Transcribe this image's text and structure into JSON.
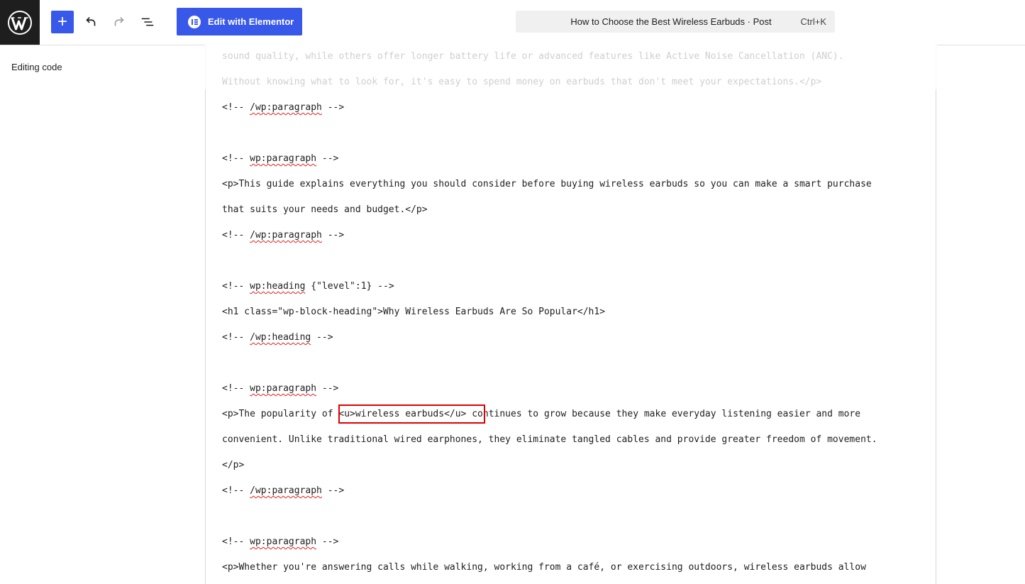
{
  "toolbar": {
    "elementor_label": "Edit with Elementor",
    "add_label": "+",
    "document_title": "How to Choose the Best Wireless Earbuds · Post",
    "shortcut": "Ctrl+K"
  },
  "sidebar": {
    "editing_label": "Editing code"
  },
  "code": {
    "lines": [
      "sound quality, while others offer longer battery life or advanced features like Active Noise Cancellation (ANC).",
      "Without knowing what to look for, it's easy to spend money on earbuds that don't meet your expectations.</p>",
      "/wp:paragraph",
      "wp:paragraph",
      "<p>This guide explains everything you should consider before buying wireless earbuds so you can make a smart purchase",
      "that suits your needs and budget.</p>",
      "/wp:paragraph",
      "wp:heading",
      " {\"level\":1} -->",
      "<h1 class=\"wp-block-heading\">Why Wireless Earbuds Are So Popular</h1>",
      "/wp:heading",
      "wp:paragraph",
      "<p>The popularity of ",
      "<u>wireless earbuds</u>",
      " continues to grow because they make everyday listening easier and more",
      "convenient. Unlike traditional wired earphones, they eliminate tangled cables and provide greater freedom of movement.",
      "</p>",
      "/wp:paragraph",
      "wp:paragraph",
      "<p>Whether you're answering calls while walking, working from a café, or exercising outdoors, wireless earbuds allow"
    ],
    "comment_open": "<!-- ",
    "comment_close": " -->"
  },
  "icons": {
    "logo": "wordpress-logo-icon",
    "undo": "undo-icon",
    "redo": "redo-icon",
    "outline": "document-overview-icon",
    "elementor": "elementor-icon"
  },
  "colors": {
    "accent": "#3858e9",
    "highlight": "#e00000",
    "spellcheck": "#e02020"
  }
}
